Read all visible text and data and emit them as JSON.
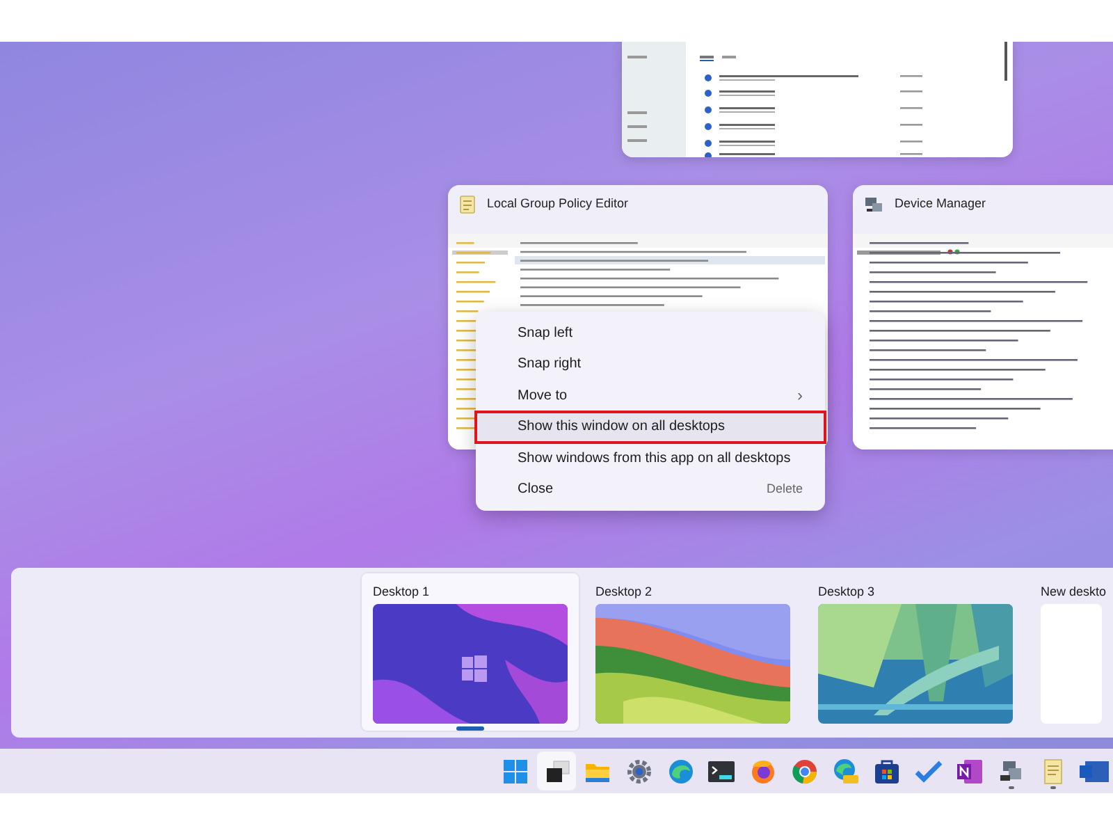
{
  "windows": [
    {
      "kind": "document"
    },
    {
      "kind": "policy",
      "title": "Local Group Policy Editor"
    },
    {
      "kind": "devices",
      "title": "Device Manager"
    }
  ],
  "context_menu": {
    "items": [
      {
        "label": "Snap left",
        "selected": false
      },
      {
        "label": "Snap right",
        "selected": false
      },
      {
        "label": "Move to",
        "submenu": "›",
        "selected": false
      },
      {
        "label": "Show this window on all desktops",
        "selected": true
      },
      {
        "label": "Show windows from this app on all desktops",
        "selected": false
      },
      {
        "label": "Close",
        "shortcut": "Delete",
        "selected": false
      }
    ]
  },
  "desktops": [
    {
      "name": "Desktop 1",
      "selected": true,
      "kind": "picture"
    },
    {
      "name": "Desktop 2",
      "selected": false,
      "kind": "picture"
    },
    {
      "name": "Desktop 3",
      "selected": false,
      "kind": "picture"
    },
    {
      "name": "New deskto",
      "selected": false,
      "kind": "blank"
    }
  ],
  "taskbar": [
    {
      "kind": "start",
      "selected": false,
      "running": false
    },
    {
      "kind": "taskview",
      "selected": true,
      "running": false
    },
    {
      "kind": "folder",
      "selected": false,
      "running": false
    },
    {
      "kind": "gear",
      "selected": false,
      "running": false
    },
    {
      "kind": "edge",
      "selected": false,
      "running": false
    },
    {
      "kind": "terminal",
      "selected": false,
      "running": false
    },
    {
      "kind": "firefox",
      "selected": false,
      "running": false
    },
    {
      "kind": "chrome",
      "selected": false,
      "running": false
    },
    {
      "kind": "edgecan",
      "selected": false,
      "running": false
    },
    {
      "kind": "store",
      "selected": false,
      "running": false
    },
    {
      "kind": "check",
      "selected": false,
      "running": false
    },
    {
      "kind": "onenote",
      "selected": false,
      "running": false
    },
    {
      "kind": "devices",
      "selected": false,
      "running": true
    },
    {
      "kind": "scroll",
      "selected": false,
      "running": true
    },
    {
      "kind": "word",
      "selected": false,
      "running": false
    }
  ]
}
